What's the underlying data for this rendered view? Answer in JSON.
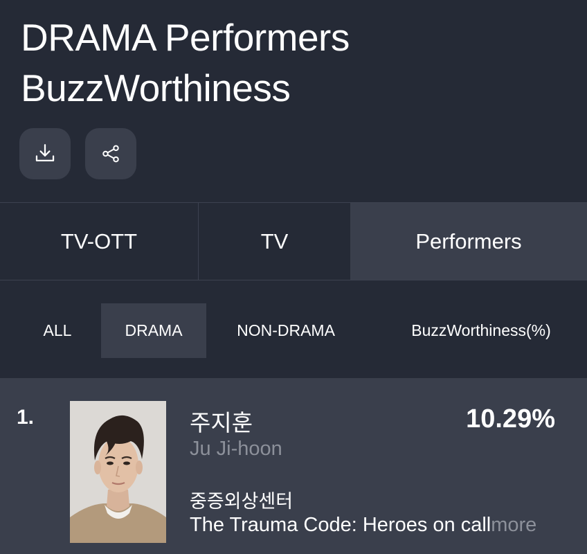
{
  "header": {
    "title_line1": "DRAMA Performers",
    "title_line2": "BuzzWorthiness"
  },
  "actions": {
    "download_icon": "download-icon",
    "share_icon": "share-icon"
  },
  "tabs": [
    {
      "label": "TV-OTT",
      "selected": false
    },
    {
      "label": "TV",
      "selected": false
    },
    {
      "label": "Performers",
      "selected": true
    }
  ],
  "filters": [
    {
      "label": "ALL",
      "selected": false
    },
    {
      "label": "DRAMA",
      "selected": true
    },
    {
      "label": "NON-DRAMA",
      "selected": false
    }
  ],
  "metric_label": "BuzzWorthiness(%)",
  "rankings": [
    {
      "rank": "1.",
      "name_ko": "주지훈",
      "name_en": "Ju Ji-hoon",
      "value": "10.29%",
      "show_ko": "중증외상센터",
      "show_en": "The Trauma Code: Heroes on call",
      "more_label": "more"
    }
  ],
  "colors": {
    "background": "#252a36",
    "selected": "#3a3f4c",
    "muted_text": "#8c909a"
  }
}
